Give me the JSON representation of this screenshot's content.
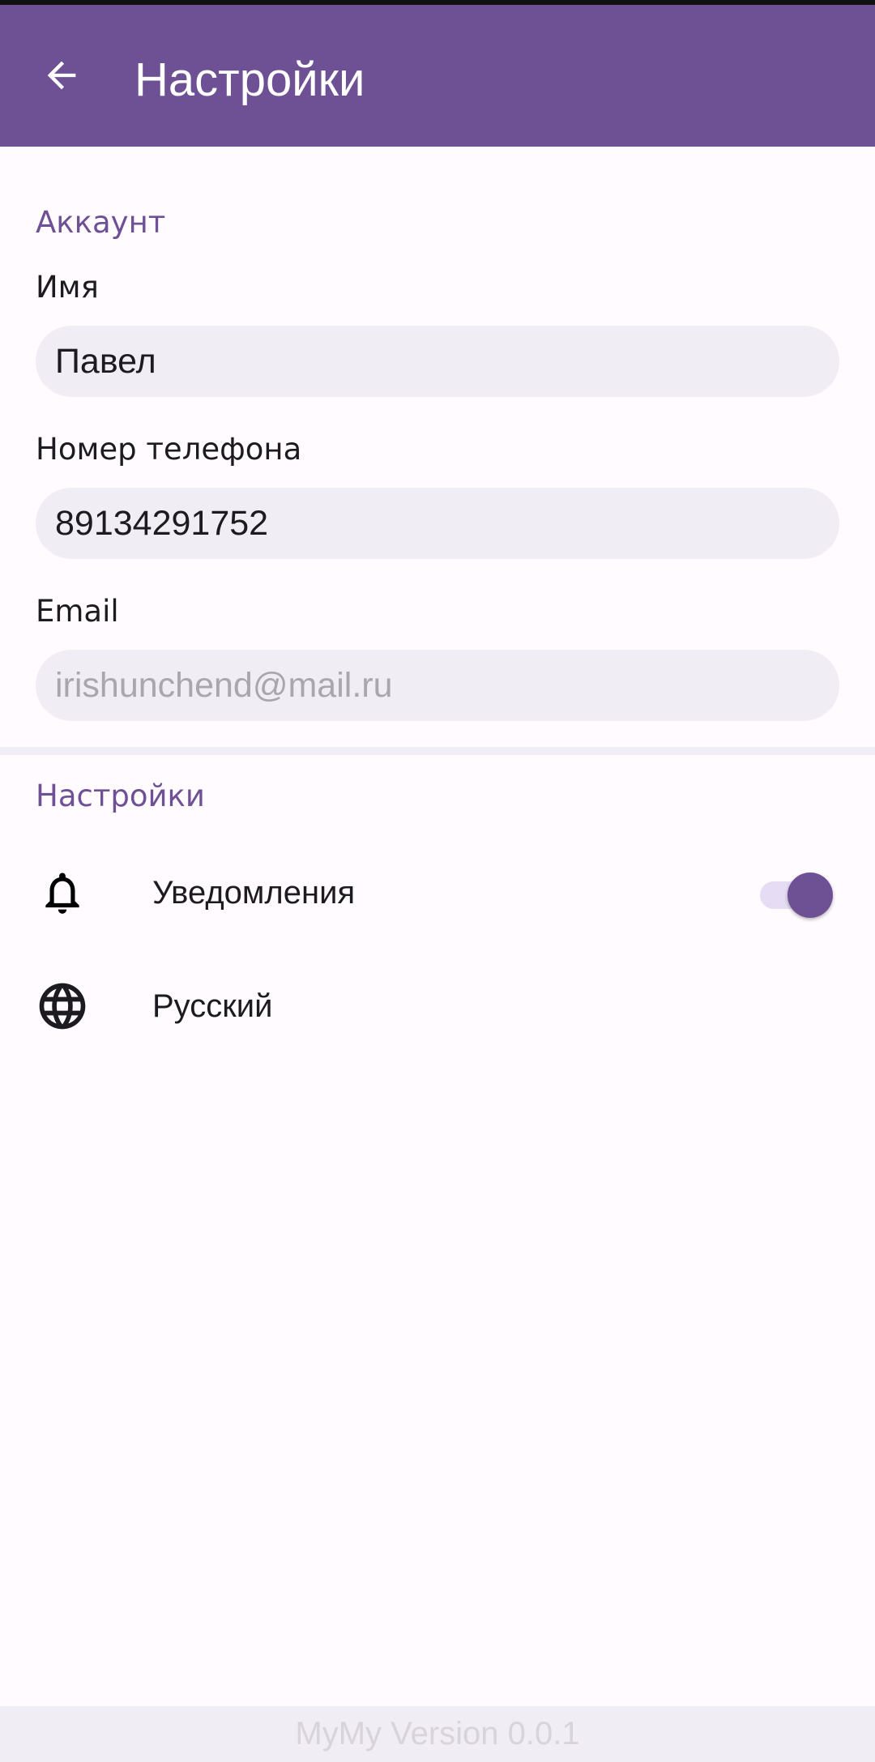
{
  "app_bar": {
    "title": "Настройки",
    "back_icon": "arrow-back-icon",
    "background": "#6e5094"
  },
  "account": {
    "section_title": "Аккаунт",
    "name_label": "Имя",
    "name_value": "Павел",
    "phone_label": "Номер телефона",
    "phone_value": "89134291752",
    "email_label": "Email",
    "email_value": "irishunchend@mail.ru"
  },
  "settings": {
    "section_title": "Настройки",
    "notifications": {
      "icon": "bell-icon",
      "label": "Уведомления",
      "enabled": true
    },
    "language": {
      "icon": "globe-icon",
      "label": "Русский"
    }
  },
  "footer": {
    "version_text": "MyMy Version 0.0.1"
  },
  "colors": {
    "accent": "#6e5094",
    "field_background": "#f1edf4",
    "toggle_track": "#e6dcf3"
  }
}
